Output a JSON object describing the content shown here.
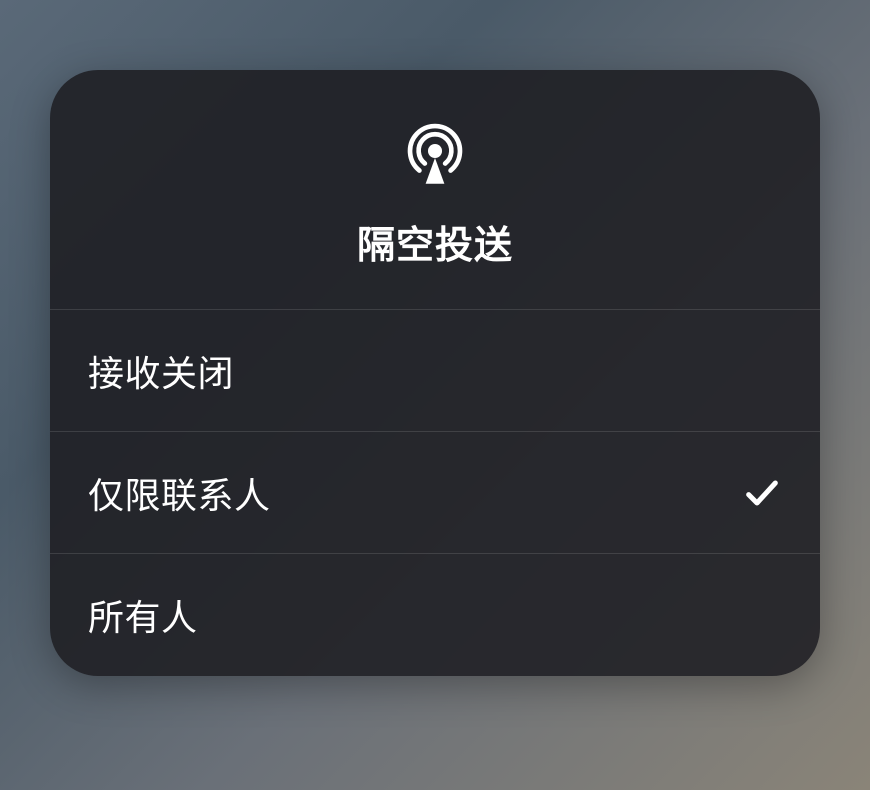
{
  "airdrop": {
    "title": "隔空投送",
    "options": [
      {
        "label": "接收关闭",
        "selected": false
      },
      {
        "label": "仅限联系人",
        "selected": true
      },
      {
        "label": "所有人",
        "selected": false
      }
    ]
  }
}
